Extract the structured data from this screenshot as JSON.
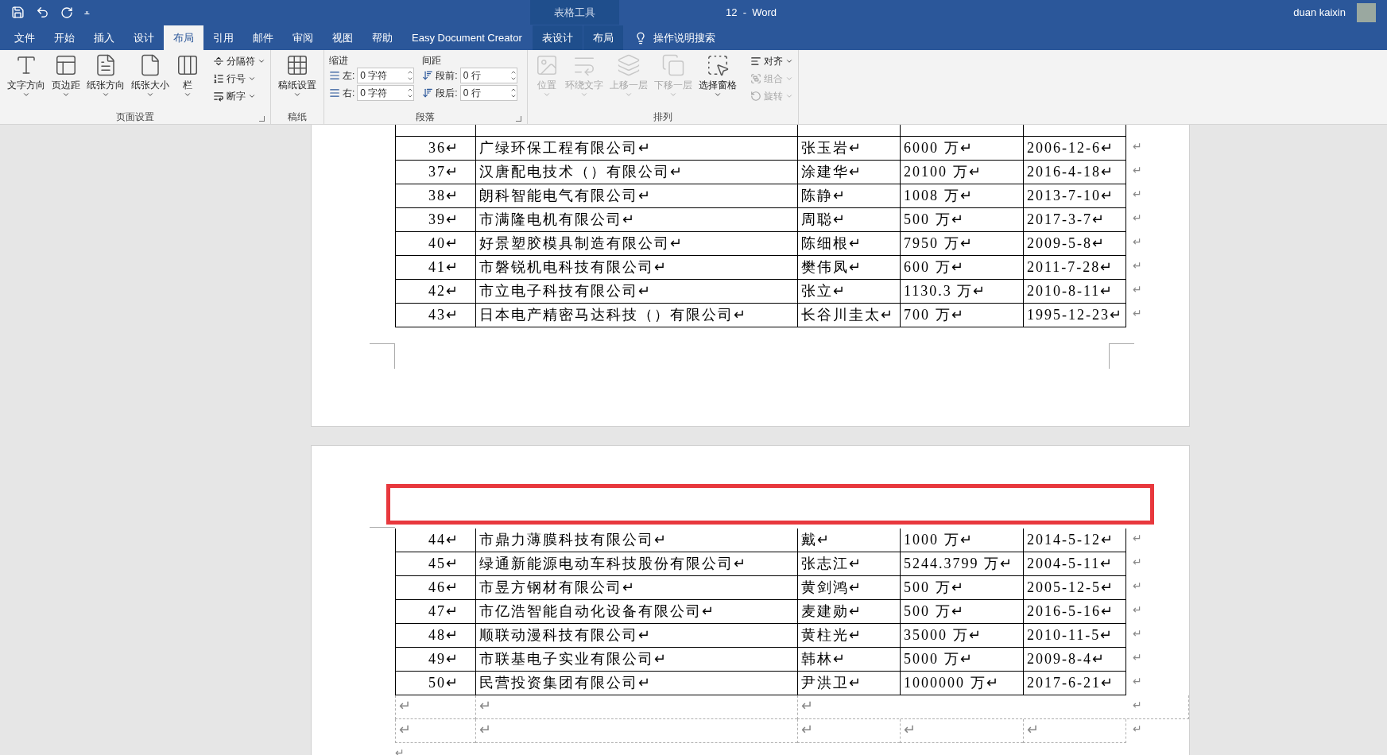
{
  "title_bar": {
    "quick_access_menu": "⩡",
    "contextual_header": "表格工具",
    "title": "12  -  Word",
    "user": "duan kaixin"
  },
  "tabs": [
    {
      "label": "文件",
      "selected": false,
      "contextual": false
    },
    {
      "label": "开始",
      "selected": false,
      "contextual": false
    },
    {
      "label": "插入",
      "selected": false,
      "contextual": false
    },
    {
      "label": "设计",
      "selected": false,
      "contextual": false
    },
    {
      "label": "布局",
      "selected": true,
      "contextual": false
    },
    {
      "label": "引用",
      "selected": false,
      "contextual": false
    },
    {
      "label": "邮件",
      "selected": false,
      "contextual": false
    },
    {
      "label": "审阅",
      "selected": false,
      "contextual": false
    },
    {
      "label": "视图",
      "selected": false,
      "contextual": false
    },
    {
      "label": "帮助",
      "selected": false,
      "contextual": false
    },
    {
      "label": "Easy Document Creator",
      "selected": false,
      "contextual": false
    },
    {
      "label": "表设计",
      "selected": false,
      "contextual": true
    },
    {
      "label": "布局",
      "selected": false,
      "contextual": true
    }
  ],
  "tell_me": "操作说明搜索",
  "ribbon": {
    "groups": [
      {
        "kind": "buttons",
        "label": "页面设置",
        "launcher": true,
        "large_buttons": [
          {
            "label": "文字方向",
            "disabled": false
          },
          {
            "label": "页边距",
            "disabled": false
          },
          {
            "label": "纸张方向",
            "disabled": false
          },
          {
            "label": "纸张大小",
            "disabled": false
          },
          {
            "label": "栏",
            "disabled": false
          }
        ],
        "small_buttons": [
          {
            "label": "分隔符",
            "disabled": false
          },
          {
            "label": "行号",
            "disabled": false
          },
          {
            "label": "断字",
            "disabled": false
          }
        ]
      },
      {
        "kind": "buttons",
        "label": "稿纸",
        "launcher": false,
        "large_buttons": [
          {
            "label": "稿纸设置",
            "disabled": false
          }
        ]
      },
      {
        "kind": "paragraph",
        "label": "段落",
        "launcher": true,
        "indent_label": "缩进",
        "spacing_label": "间距",
        "indent": [
          {
            "label": "左:",
            "value": "0 字符"
          },
          {
            "label": "右:",
            "value": "0 字符"
          }
        ],
        "spacing": [
          {
            "label": "段前:",
            "value": "0 行"
          },
          {
            "label": "段后:",
            "value": "0 行"
          }
        ]
      },
      {
        "kind": "buttons",
        "label": "排列",
        "launcher": false,
        "large_buttons": [
          {
            "label": "位置",
            "disabled": true
          },
          {
            "label": "环绕文字",
            "disabled": true
          },
          {
            "label": "上移一层",
            "disabled": true
          },
          {
            "label": "下移一层",
            "disabled": true
          },
          {
            "label": "选择窗格",
            "disabled": false
          }
        ],
        "small_buttons": [
          {
            "label": "对齐",
            "disabled": false
          },
          {
            "label": "组合",
            "disabled": true
          },
          {
            "label": "旋转",
            "disabled": true
          }
        ]
      }
    ]
  },
  "page_1_table": {
    "rows": [
      {
        "kind": "bordered",
        "merge_tail": false,
        "cells": [
          "36↵",
          "广绿环保工程有限公司↵",
          "张玉岩↵",
          "6000 万↵",
          "2006-12-6↵"
        ],
        "end": "↵"
      },
      {
        "kind": "bordered",
        "merge_tail": false,
        "cells": [
          "37↵",
          "汉唐配电技术（）有限公司↵",
          "涂建华↵",
          "20100 万↵",
          "2016-4-18↵"
        ],
        "end": "↵"
      },
      {
        "kind": "bordered",
        "merge_tail": false,
        "cells": [
          "38↵",
          "朗科智能电气有限公司↵",
          "陈静↵",
          "1008 万↵",
          "2013-7-10↵"
        ],
        "end": "↵"
      },
      {
        "kind": "bordered",
        "merge_tail": false,
        "cells": [
          "39↵",
          "市满隆电机有限公司↵",
          "周聪↵",
          "500 万↵",
          "2017-3-7↵"
        ],
        "end": "↵"
      },
      {
        "kind": "bordered",
        "merge_tail": false,
        "cells": [
          "40↵",
          "好景塑胶模具制造有限公司↵",
          "陈细根↵",
          "7950 万↵",
          "2009-5-8↵"
        ],
        "end": "↵"
      },
      {
        "kind": "bordered",
        "merge_tail": false,
        "cells": [
          "41↵",
          "市磐锐机电科技有限公司↵",
          "樊伟凤↵",
          "600 万↵",
          "2011-7-28↵"
        ],
        "end": "↵"
      },
      {
        "kind": "bordered",
        "merge_tail": false,
        "cells": [
          "42↵",
          "市立电子科技有限公司↵",
          "张立↵",
          "1130.3 万↵",
          "2010-8-11↵"
        ],
        "end": "↵"
      },
      {
        "kind": "bordered",
        "merge_tail": false,
        "cells": [
          "43↵",
          "日本电产精密马达科技（）有限公司↵",
          "长谷川圭太↵",
          "700 万↵",
          "1995-12-23↵"
        ],
        "end": "↵"
      }
    ]
  },
  "page_2_table": {
    "rows": [
      {
        "kind": "bordered",
        "merge_tail": false,
        "cells": [
          "44↵",
          "市鼎力薄膜科技有限公司↵",
          "戴↵",
          "1000 万↵",
          "2014-5-12↵"
        ],
        "end": "↵"
      },
      {
        "kind": "bordered",
        "merge_tail": false,
        "cells": [
          "45↵",
          "绿通新能源电动车科技股份有限公司↵",
          "张志江↵",
          "5244.3799 万↵",
          "2004-5-11↵"
        ],
        "end": "↵"
      },
      {
        "kind": "bordered",
        "merge_tail": false,
        "cells": [
          "46↵",
          "市昱方钢材有限公司↵",
          "黄剑鸿↵",
          "500 万↵",
          "2005-12-5↵"
        ],
        "end": "↵"
      },
      {
        "kind": "bordered",
        "merge_tail": false,
        "cells": [
          "47↵",
          "市亿浩智能自动化设备有限公司↵",
          "麦建勋↵",
          "500 万↵",
          "2016-5-16↵"
        ],
        "end": "↵"
      },
      {
        "kind": "bordered",
        "merge_tail": false,
        "cells": [
          "48↵",
          "顺联动漫科技有限公司↵",
          "黄柱光↵",
          "35000 万↵",
          "2010-11-5↵"
        ],
        "end": "↵"
      },
      {
        "kind": "bordered",
        "merge_tail": false,
        "cells": [
          "49↵",
          "市联基电子实业有限公司↵",
          "韩林↵",
          "5000 万↵",
          "2009-8-4↵"
        ],
        "end": "↵"
      },
      {
        "kind": "bordered",
        "merge_tail": false,
        "cells": [
          "50↵",
          "民营投资集团有限公司↵",
          "尹洪卫↵",
          "1000000 万↵",
          "2017-6-21↵"
        ],
        "end": "↵"
      },
      {
        "kind": "gridline",
        "merge_tail": true,
        "cells": [
          "↵",
          "↵",
          "↵"
        ],
        "end": "↵"
      },
      {
        "kind": "gridline",
        "merge_tail": false,
        "cells": [
          "↵",
          "↵",
          "↵",
          "↵",
          "↵"
        ],
        "end": "↵"
      }
    ],
    "after_mark": "↵"
  }
}
